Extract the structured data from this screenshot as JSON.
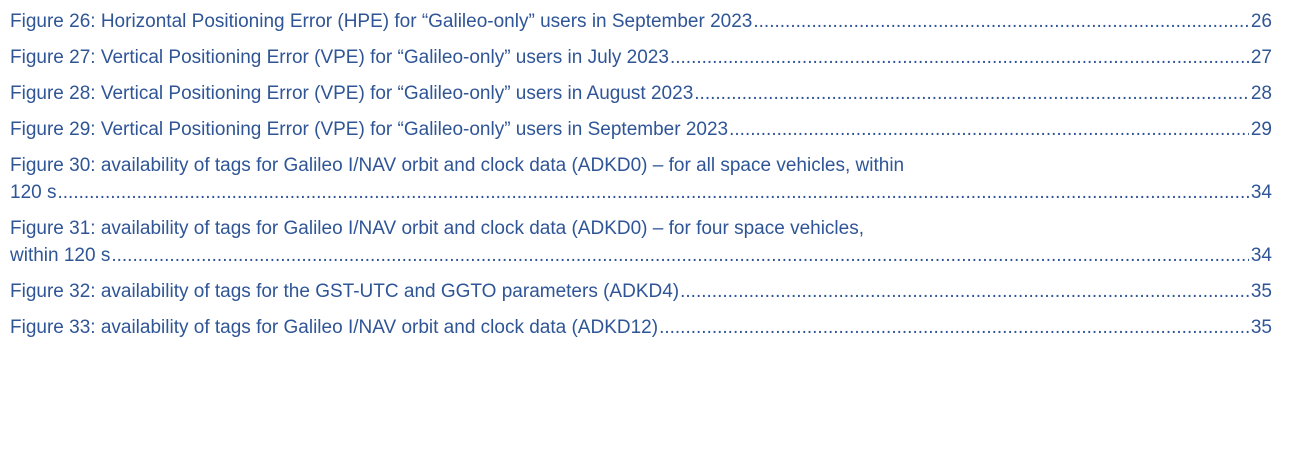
{
  "toc_entries": [
    {
      "title": "Figure 26: Horizontal Positioning Error (HPE) for “Galileo-only” users in September 2023",
      "page": "26"
    },
    {
      "title": "Figure 27: Vertical Positioning Error (VPE) for “Galileo-only” users in July 2023",
      "page": "27"
    },
    {
      "title": "Figure 28: Vertical Positioning Error (VPE) for “Galileo-only” users in August 2023",
      "page": "28"
    },
    {
      "title": "Figure 29: Vertical Positioning Error (VPE) for “Galileo-only” users in September 2023",
      "page": "29"
    },
    {
      "title_line1": "Figure 30: availability of tags for Galileo I/NAV orbit and clock data (ADKD0) – for all space vehicles, within",
      "title_line2": "120 s",
      "page": "34"
    },
    {
      "title_line1": "Figure 31: availability of tags for Galileo I/NAV orbit and clock data (ADKD0) – for four space vehicles,",
      "title_line2": "within 120 s",
      "page": "34"
    },
    {
      "title": "Figure 32: availability of tags for the GST-UTC and GGTO parameters (ADKD4)",
      "page": "35"
    },
    {
      "title": "Figure 33: availability of tags for Galileo I/NAV orbit and clock data (ADKD12)",
      "page": "35"
    }
  ]
}
